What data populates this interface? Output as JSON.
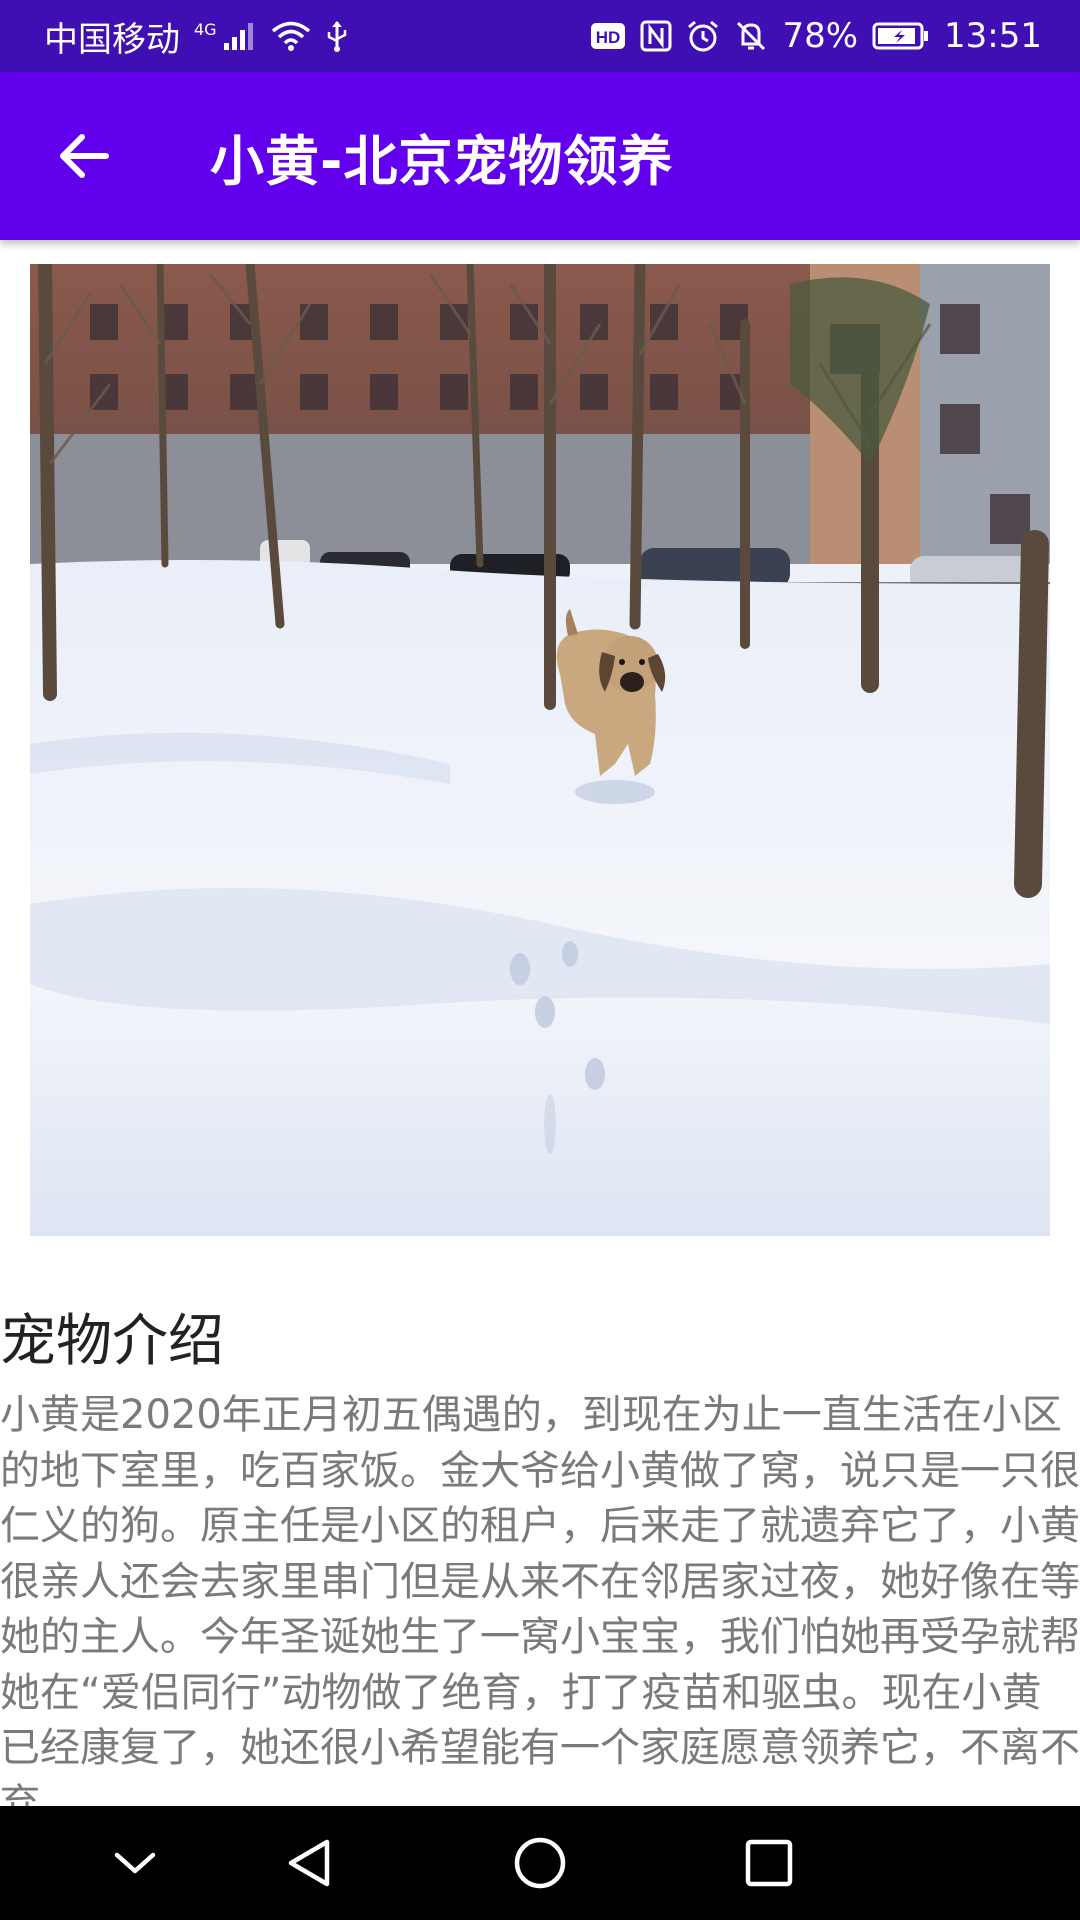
{
  "status_bar": {
    "carrier": "中国移动",
    "network": "4G",
    "battery": "78%",
    "time": "13:51",
    "icons": [
      "signal-icon",
      "wifi-icon",
      "usb-icon",
      "hd-icon",
      "nfc-icon",
      "alarm-icon",
      "mute-icon",
      "battery-icon"
    ]
  },
  "app_bar": {
    "back_icon": "arrow-back-icon",
    "title": "小黄-北京宠物领养"
  },
  "photo": {
    "subject": "pet-photo"
  },
  "content": {
    "section_title": "宠物介绍",
    "description": "小黄是2020年正月初五偶遇的，到现在为止一直生活在小区的地下室里，吃百家饭。金大爷给小黄做了窝，说只是一只很仁义的狗。原主任是小区的租户，后来走了就遗弃它了，小黄很亲人还会去家里串门但是从来不在邻居家过夜，她好像在等她的主人。今年圣诞她生了一窝小宝宝，我们怕她再受孕就帮她在“爱侣同行”动物做了绝育，打了疫苗和驱虫。现在小黄已经康复了，她还很小希望能有一个家庭愿意领养它，不离不弃。"
  },
  "nav_bar": {
    "icons": [
      "chevron-down-icon",
      "back-triangle-icon",
      "home-circle-icon",
      "recents-square-icon"
    ]
  },
  "colors": {
    "status_bar": "#3f0fb3",
    "app_bar": "#6200ee",
    "body_text": "#7a7a7a",
    "title_text": "#222222"
  }
}
